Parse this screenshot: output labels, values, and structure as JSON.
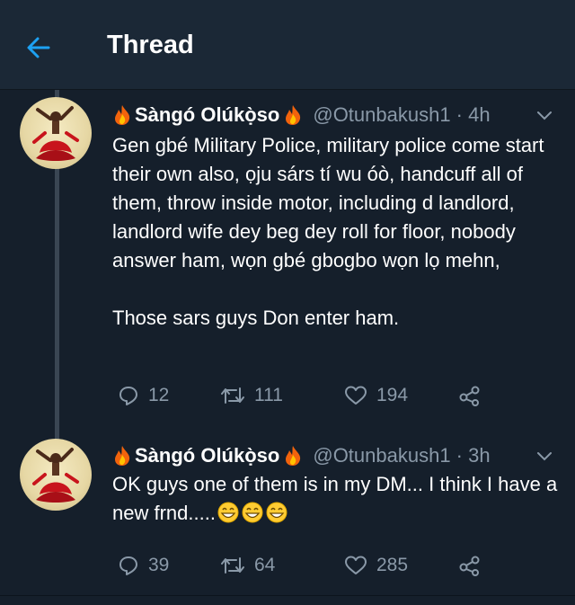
{
  "header": {
    "title": "Thread",
    "back_icon": "arrow-left-icon"
  },
  "colors": {
    "accent": "#1da1f2",
    "background": "#151f2b",
    "muted": "#8a99a8"
  },
  "tweets": [
    {
      "name": "Sàngó Olúkọ̀so",
      "handle": "@Otunbakush1 · 4h",
      "text": "Gen gbé Military Police, military police come start their own also, ọju sárs tí wu óò, handcuff all of them, throw inside motor, including d landlord, landlord wife dey beg dey roll for floor, nobody answer ham, wọn gbé gbogbo wọn lọ mehn,\n\nThose sars guys Don enter ham.",
      "replies": "12",
      "retweets": "111",
      "likes": "194"
    },
    {
      "name": "Sàngó Olúkọ̀so",
      "handle": "@Otunbakush1 · 3h",
      "text": "OK guys one of them is in my DM... I think I have a new frnd.....",
      "replies": "39",
      "retweets": "64",
      "likes": "285"
    }
  ]
}
